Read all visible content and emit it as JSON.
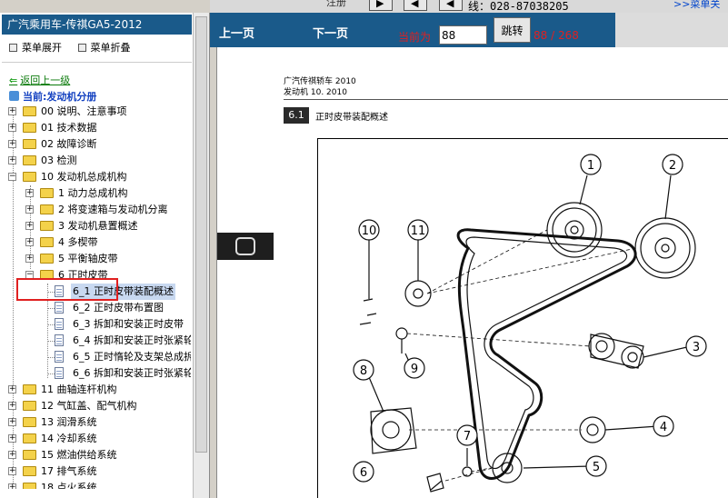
{
  "topbar": {
    "garbled_text": "注册",
    "phone": "线：028-87038205",
    "menu_link": ">>菜单关"
  },
  "sidebar": {
    "title": "广汽乘用车-传祺GA5-2012",
    "expand_label": "菜单展开",
    "collapse_label": "菜单折叠",
    "back_label": "返回上一级",
    "current_label": "当前:发动机分册",
    "items": [
      {
        "label": "00  说明、注意事项"
      },
      {
        "label": "01  技术数据"
      },
      {
        "label": "02  故障诊断"
      },
      {
        "label": "03  检测"
      },
      {
        "label": "10  发动机总成机构"
      },
      {
        "label": "1  动力总成机构"
      },
      {
        "label": "2  将变速箱与发动机分离"
      },
      {
        "label": "3  发动机悬置概述"
      },
      {
        "label": "4  多楔带"
      },
      {
        "label": "5  平衡轴皮带"
      },
      {
        "label": "6  正时皮带"
      },
      {
        "label": "6_1  正时皮带装配概述"
      },
      {
        "label": "6_2  正时皮带布置图"
      },
      {
        "label": "6_3  拆卸和安装正时皮带"
      },
      {
        "label": "6_4  拆卸和安装正时张紧轮"
      },
      {
        "label": "6_5  正时惰轮及支架总成拆"
      },
      {
        "label": "6_6  拆卸和安装正时张紧轮"
      },
      {
        "label": "11  曲轴连杆机构"
      },
      {
        "label": "12  气缸盖、配气机构"
      },
      {
        "label": "13  润滑系统"
      },
      {
        "label": "14  冷却系统"
      },
      {
        "label": "15  燃油供给系统"
      },
      {
        "label": "17  排气系统"
      },
      {
        "label": "18  点火系统"
      }
    ]
  },
  "nav": {
    "prev_label": "上一页",
    "next_label": "下一页",
    "current_label": "当前为",
    "page_value": "88",
    "jump_label": "跳转",
    "page_count": "88 / 268"
  },
  "document": {
    "header_line1": "广汽传祺轿车 2010",
    "header_line2": "发动机 10. 2010",
    "section_number": "6.1",
    "section_title": "正时皮带装配概述",
    "callouts": [
      "1",
      "2",
      "3",
      "4",
      "5",
      "6",
      "7",
      "8",
      "9",
      "10",
      "11"
    ]
  }
}
